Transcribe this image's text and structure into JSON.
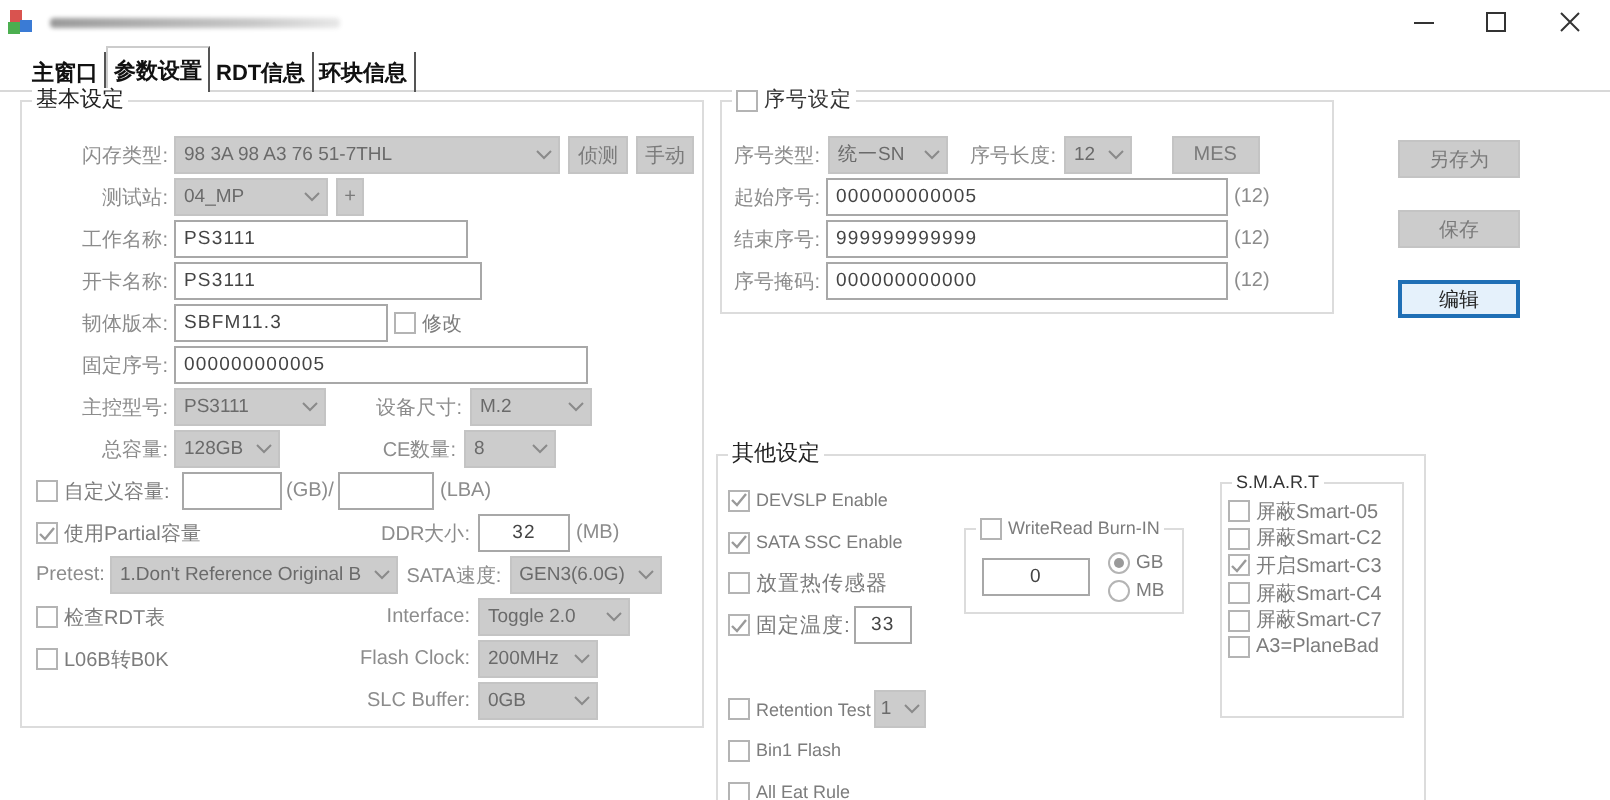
{
  "tabs": [
    {
      "label": "主窗口",
      "selected": false
    },
    {
      "label": "参数设置",
      "selected": true
    },
    {
      "label": "RDT信息",
      "selected": false
    },
    {
      "label": "环块信息",
      "selected": false
    }
  ],
  "basic_settings": {
    "title": "基本设定",
    "rows": [
      [
        {
          "kind": "label",
          "text": "闪存类型:"
        },
        {
          "kind": "combo",
          "value": "98 3A 98 A3 76 51-7THL",
          "disabled": true
        },
        {
          "kind": "button",
          "label": "侦测",
          "disabled": true
        },
        {
          "kind": "button",
          "label": "手动",
          "disabled": true
        }
      ],
      [
        {
          "kind": "label",
          "text": "测试站:"
        },
        {
          "kind": "combo",
          "value": "04_MP",
          "disabled": true
        },
        {
          "kind": "button",
          "label": "+",
          "disabled": true
        }
      ],
      [
        {
          "kind": "label",
          "text": "工作名称:"
        },
        {
          "kind": "input",
          "value": "PS3111"
        }
      ],
      [
        {
          "kind": "label",
          "text": "开卡名称:"
        },
        {
          "kind": "input",
          "value": "PS3111"
        }
      ],
      [
        {
          "kind": "label",
          "text": "韧体版本:"
        },
        {
          "kind": "input",
          "value": "SBFM11.3"
        },
        {
          "kind": "checkbox",
          "label": "修改",
          "checked": false
        }
      ],
      [
        {
          "kind": "label",
          "text": "固定序号:"
        },
        {
          "kind": "input",
          "value": "000000000005"
        }
      ],
      [
        {
          "kind": "label",
          "text": "主控型号:"
        },
        {
          "kind": "combo",
          "value": "PS3111",
          "disabled": true
        },
        {
          "kind": "label",
          "text": "设备尺寸:"
        },
        {
          "kind": "combo",
          "value": "M.2",
          "disabled": true
        }
      ],
      [
        {
          "kind": "label",
          "text": "总容量:"
        },
        {
          "kind": "combo",
          "value": "128GB",
          "disabled": true
        },
        {
          "kind": "label",
          "text": "CE数量:"
        },
        {
          "kind": "combo",
          "value": "8",
          "disabled": true
        }
      ],
      [
        {
          "kind": "checkbox",
          "label": "自定义容量:",
          "checked": false
        },
        {
          "kind": "input"
        },
        {
          "kind": "unit",
          "text": "(GB)/"
        },
        {
          "kind": "input"
        },
        {
          "kind": "unit",
          "text": "(LBA)"
        }
      ],
      [
        {
          "kind": "checkbox",
          "label": "使用Partial容量",
          "checked": true
        },
        {
          "kind": "label",
          "text": "DDR大小:"
        },
        {
          "kind": "input",
          "value": "32"
        },
        {
          "kind": "unit",
          "text": "(MB)"
        }
      ],
      [
        {
          "kind": "label",
          "text": "Pretest:"
        },
        {
          "kind": "combo",
          "value": "1.Don't Reference Original B",
          "disabled": true
        },
        {
          "kind": "label",
          "text": "SATA速度:"
        },
        {
          "kind": "combo",
          "value": "GEN3(6.0G)",
          "disabled": true
        }
      ],
      [
        {
          "kind": "checkbox",
          "label": "检查RDT表",
          "checked": false
        },
        {
          "kind": "label",
          "text": "Interface:"
        },
        {
          "kind": "combo",
          "value": "Toggle 2.0",
          "disabled": true
        }
      ],
      [
        {
          "kind": "checkbox",
          "label": "L06B转B0K",
          "checked": false
        },
        {
          "kind": "label",
          "text": "Flash Clock:"
        },
        {
          "kind": "combo",
          "value": "200MHz",
          "disabled": true
        }
      ],
      [
        {
          "kind": "label",
          "text": "SLC Buffer:"
        },
        {
          "kind": "combo",
          "value": "0GB",
          "disabled": true
        }
      ]
    ]
  },
  "serial_settings": {
    "title": "序号设定",
    "enabled": false,
    "rows": [
      [
        {
          "kind": "label",
          "text": "序号类型:"
        },
        {
          "kind": "combo",
          "value": "统一SN",
          "disabled": true
        },
        {
          "kind": "label",
          "text": "序号长度:"
        },
        {
          "kind": "combo",
          "value": "12",
          "disabled": true
        },
        {
          "kind": "button",
          "label": "MES",
          "disabled": true
        }
      ],
      [
        {
          "kind": "label",
          "text": "起始序号:"
        },
        {
          "kind": "input",
          "value": "000000000005"
        },
        {
          "kind": "unit",
          "text": "(12)"
        }
      ],
      [
        {
          "kind": "label",
          "text": "结束序号:"
        },
        {
          "kind": "input",
          "value": "999999999999"
        },
        {
          "kind": "unit",
          "text": "(12)"
        }
      ],
      [
        {
          "kind": "label",
          "text": "序号掩码:"
        },
        {
          "kind": "input",
          "value": "000000000000"
        },
        {
          "kind": "unit",
          "text": "(12)"
        }
      ]
    ]
  },
  "action_buttons": [
    {
      "label": "另存为",
      "disabled": true,
      "focused": false
    },
    {
      "label": "保存",
      "disabled": true,
      "focused": false
    },
    {
      "label": "编辑",
      "disabled": false,
      "focused": true
    }
  ],
  "other_settings": {
    "title": "其他设定",
    "options": [
      {
        "kind": "checkbox",
        "label": "DEVSLP Enable",
        "checked": true
      },
      {
        "kind": "checkbox",
        "label": "SATA SSC Enable",
        "checked": true
      },
      {
        "kind": "checkbox",
        "label": "放置热传感器",
        "checked": false
      },
      {
        "kind": "checkbox_input",
        "label": "固定温度:",
        "checked": true,
        "value": "33"
      },
      {
        "kind": "checkbox_combo",
        "label": "Retention Test",
        "checked": false,
        "value": "1",
        "disabled": true
      },
      {
        "kind": "checkbox",
        "label": "Bin1 Flash",
        "checked": false
      },
      {
        "kind": "checkbox",
        "label": "All Eat Rule",
        "checked": false
      }
    ],
    "burn_in": {
      "title": "WriteRead Burn-IN",
      "checked": false,
      "value": "0",
      "units": [
        {
          "label": "GB",
          "selected": true
        },
        {
          "label": "MB",
          "selected": false
        }
      ]
    },
    "smart": {
      "title": "S.M.A.R.T",
      "items": [
        {
          "label": "屏蔽Smart-05",
          "checked": false
        },
        {
          "label": "屏蔽Smart-C2",
          "checked": false
        },
        {
          "label": "开启Smart-C3",
          "checked": true
        },
        {
          "label": "屏蔽Smart-C4",
          "checked": false
        },
        {
          "label": "屏蔽Smart-C7",
          "checked": false
        },
        {
          "label": "A3=PlaneBad",
          "checked": false
        }
      ]
    }
  }
}
